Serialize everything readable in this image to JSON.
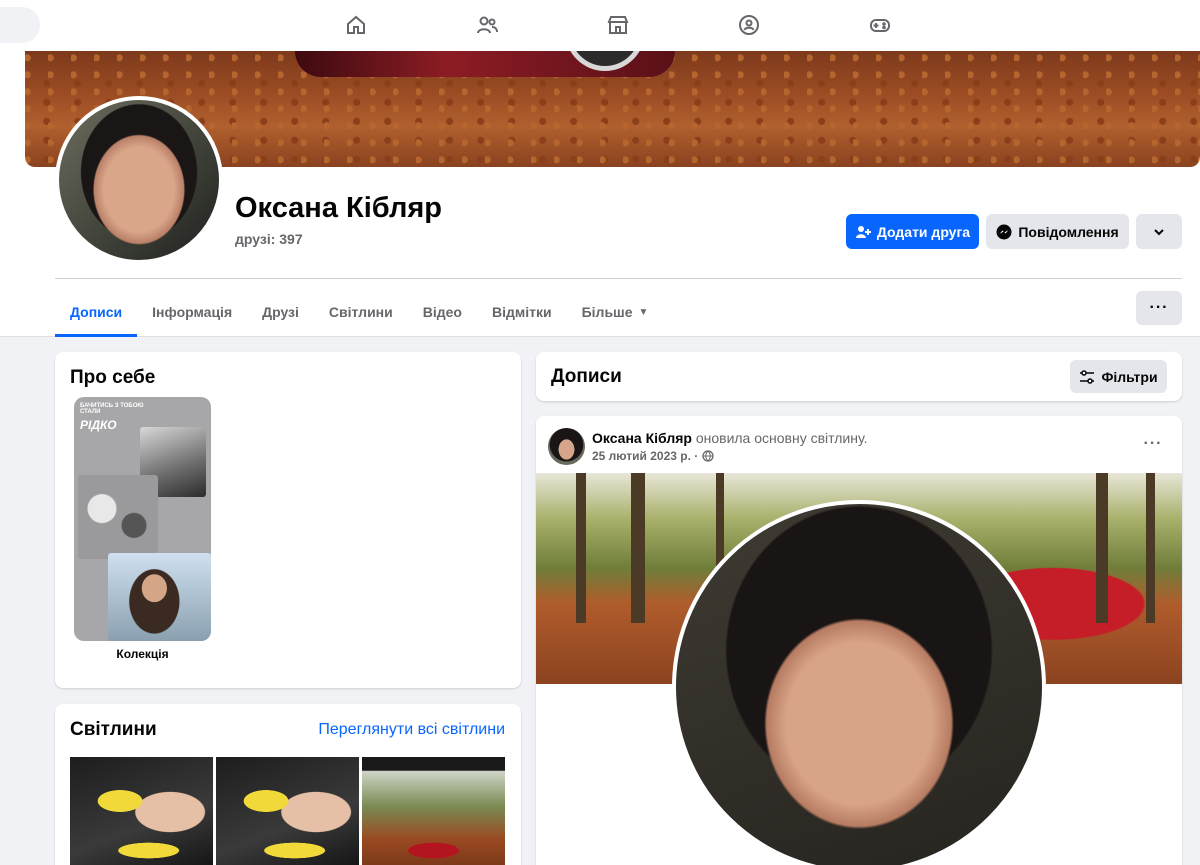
{
  "nav": {
    "icons": [
      "home-icon",
      "friends-icon",
      "marketplace-icon",
      "groups-icon",
      "gaming-icon"
    ]
  },
  "profile": {
    "name": "Оксана Кібляр",
    "friends": "друзі: 397",
    "add_friend_label": "Додати друга",
    "message_label": "Повідомлення"
  },
  "tabs": [
    {
      "label": "Дописи",
      "active": true
    },
    {
      "label": "Інформація"
    },
    {
      "label": "Друзі"
    },
    {
      "label": "Світлини"
    },
    {
      "label": "Відео"
    },
    {
      "label": "Відмітки"
    },
    {
      "label": "Більше"
    }
  ],
  "about": {
    "title": "Про себе",
    "collection_label": "Колекція",
    "collection_small_text": "БАЧИТИСЬ З ТОБОЮ СТАЛИ",
    "collection_big_text": "РІДКО"
  },
  "photos": {
    "title": "Світлини",
    "see_all": "Переглянути всі світлини"
  },
  "posts": {
    "title": "Дописи",
    "filters_label": "Фільтри"
  },
  "post": {
    "author": "Оксана Кібляр",
    "action": "оновила основну світлину.",
    "date": "25 лютий 2023 р. ·"
  },
  "colors": {
    "accent": "#0866ff",
    "background": "#f0f2f5",
    "secondary_button": "#e4e6eb",
    "muted_text": "#65676b"
  }
}
